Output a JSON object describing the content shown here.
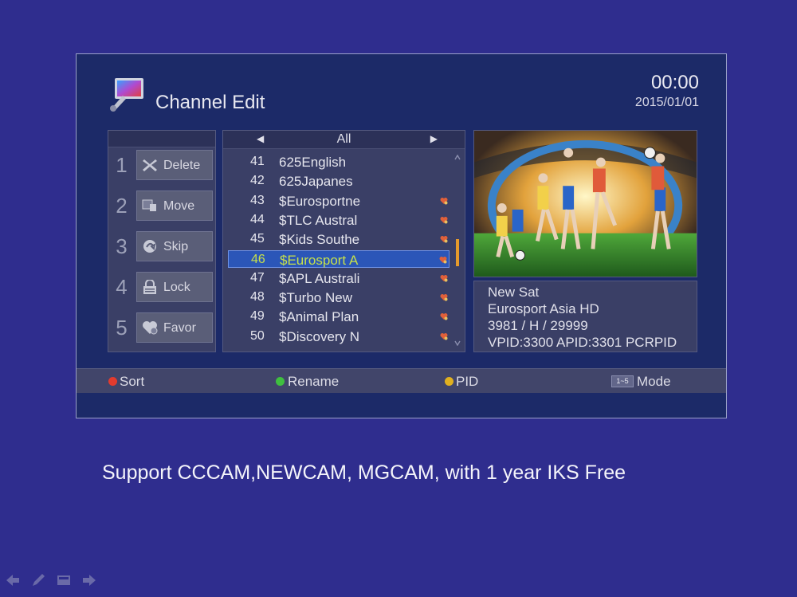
{
  "header": {
    "title": "Channel Edit",
    "time": "00:00",
    "date": "2015/01/01"
  },
  "menu": {
    "items": [
      {
        "number": "1",
        "label": "Delete",
        "icon": "delete-icon"
      },
      {
        "number": "2",
        "label": "Move",
        "icon": "move-icon"
      },
      {
        "number": "3",
        "label": "Skip",
        "icon": "skip-icon"
      },
      {
        "number": "4",
        "label": "Lock",
        "icon": "lock-icon"
      },
      {
        "number": "5",
        "label": "Favor",
        "icon": "favorite-icon"
      }
    ]
  },
  "channel_list": {
    "filter": "All",
    "rows": [
      {
        "number": "41",
        "name": "625English",
        "tag": false
      },
      {
        "number": "42",
        "name": "625Japanes",
        "tag": false
      },
      {
        "number": "43",
        "name": "$Eurosportne",
        "tag": true
      },
      {
        "number": "44",
        "name": "$TLC Austral",
        "tag": true
      },
      {
        "number": "45",
        "name": "$Kids Southe",
        "tag": true
      },
      {
        "number": "46",
        "name": "$Eurosport A",
        "tag": true,
        "selected": true
      },
      {
        "number": "47",
        "name": "$APL Australi",
        "tag": true
      },
      {
        "number": "48",
        "name": "$Turbo New",
        "tag": true
      },
      {
        "number": "49",
        "name": "$Animal Plan",
        "tag": true
      },
      {
        "number": "50",
        "name": "$Discovery N",
        "tag": true
      }
    ]
  },
  "info": {
    "satellite": "New Sat",
    "channel": "Eurosport Asia HD",
    "transponder": "3981 / H / 29999",
    "pids": "VPID:3300 APID:3301 PCRPID"
  },
  "footer": {
    "sort": "Sort",
    "rename": "Rename",
    "pid": "PID",
    "mode_badge": "1~5",
    "mode": "Mode"
  },
  "colors": {
    "red": "#e23b2e",
    "green": "#3fbf3f",
    "yellow": "#e0b020",
    "highlight_text": "#c6e04a"
  },
  "caption": "Support CCCAM,NEWCAM, MGCAM, with 1 year IKS Free",
  "navbar": [
    "previous-icon",
    "pen-icon",
    "screen-icon",
    "next-icon"
  ]
}
